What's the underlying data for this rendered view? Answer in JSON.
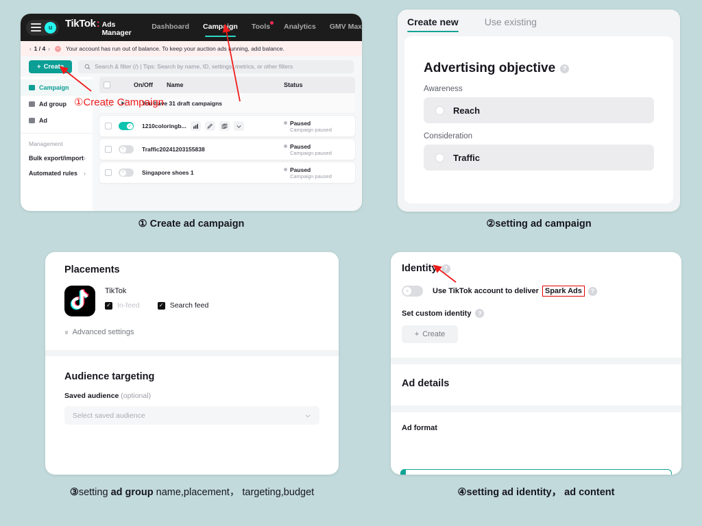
{
  "background_color": "#c2dadb",
  "accent_teal": "#11a394",
  "annotation_red": "#ef1a1a",
  "panel1": {
    "name": "tiktok-ads-manager",
    "topbar": {
      "avatar_letter": "u",
      "brand": "TikTok",
      "brand_colon": ":",
      "brand_sub": "Ads Manager",
      "nav": [
        {
          "label": "Dashboard",
          "active": false,
          "dot": false
        },
        {
          "label": "Campaign",
          "active": true,
          "dot": false
        },
        {
          "label": "Tools",
          "active": false,
          "dot": true
        },
        {
          "label": "Analytics",
          "active": false,
          "dot": false
        },
        {
          "label": "GMV Max",
          "active": false,
          "dot": false
        }
      ]
    },
    "alert": {
      "page_indicator": "1 / 4",
      "prev": "‹",
      "next": "›",
      "message": "Your account has run out of balance. To keep your auction ads running, add balance."
    },
    "toolbar": {
      "create_label": "Create",
      "create_plus": "+",
      "search_placeholder": "Search & filter (/) | Tips: Search by name, ID, settings, metrics, or other filters"
    },
    "sidebar": {
      "items": [
        {
          "label": "Campaign",
          "active": true
        },
        {
          "label": "Ad group",
          "active": false
        },
        {
          "label": "Ad",
          "active": false
        }
      ],
      "group_title": "Management",
      "sub_items": [
        {
          "label": "Bulk export/import"
        },
        {
          "label": "Automated rules"
        }
      ]
    },
    "table": {
      "headers": {
        "onoff": "On/Off",
        "name": "Name",
        "status": "Status"
      },
      "draft_row": {
        "label": "You have 31 draft campaigns"
      },
      "rows": [
        {
          "name": "1210coloringb...",
          "toggle_on": true,
          "status": "Paused",
          "status_sub": "Campaign paused",
          "actions": [
            "analytics-icon",
            "edit-icon",
            "duplicate-icon",
            "chevron-down-icon"
          ]
        },
        {
          "name": "Traffic20241203155838",
          "toggle_on": false,
          "status": "Paused",
          "status_sub": "Campaign paused",
          "actions": []
        },
        {
          "name": "Singapore shoes 1",
          "toggle_on": false,
          "status": "Paused",
          "status_sub": "Campaign paused",
          "actions": []
        }
      ]
    }
  },
  "panel2": {
    "name": "advertising-objective",
    "tabs": [
      {
        "label": "Create new",
        "active": true
      },
      {
        "label": "Use existing",
        "active": false
      }
    ],
    "title": "Advertising objective",
    "help": "?",
    "groups": [
      {
        "group_label": "Awareness",
        "option": "Reach"
      },
      {
        "group_label": "Consideration",
        "option": "Traffic"
      }
    ]
  },
  "panel3": {
    "name": "placements-and-targeting",
    "placements_title": "Placements",
    "platform": "TikTok",
    "checkboxes": [
      {
        "label": "In-feed",
        "checked": true,
        "dimmed": true
      },
      {
        "label": "Search feed",
        "checked": true,
        "dimmed": false
      }
    ],
    "advanced_settings": "Advanced settings",
    "advanced_chevron": "»",
    "audience_title": "Audience targeting",
    "saved_audience_label": "Saved audience",
    "saved_audience_optional": "(optional)",
    "saved_audience_placeholder": "Select saved audience"
  },
  "panel4": {
    "name": "identity-and-ad-details",
    "identity_title": "Identity",
    "help": "?",
    "toggle_label_prefix": "Use TikTok account to deliver",
    "toggle_label_highlight": "Spark Ads",
    "toggle_on": false,
    "custom_identity_label": "Set custom identity",
    "create_button": "Create",
    "create_plus": "+",
    "ad_details_title": "Ad details",
    "ad_format_title": "Ad format"
  },
  "captions": {
    "c1_num": "①",
    "c1_text": " Create ad campaign",
    "c2_num": "②",
    "c2_text": "setting ad campaign",
    "c3_num": "③",
    "c3_a": "setting ",
    "c3_b": "ad group ",
    "c3_c": "name,placement， targeting,budget",
    "c4_num": "④",
    "c4_text": "setting ad identity， ad content"
  },
  "annotations": {
    "create_campaign_label": "①Create Campaign"
  }
}
